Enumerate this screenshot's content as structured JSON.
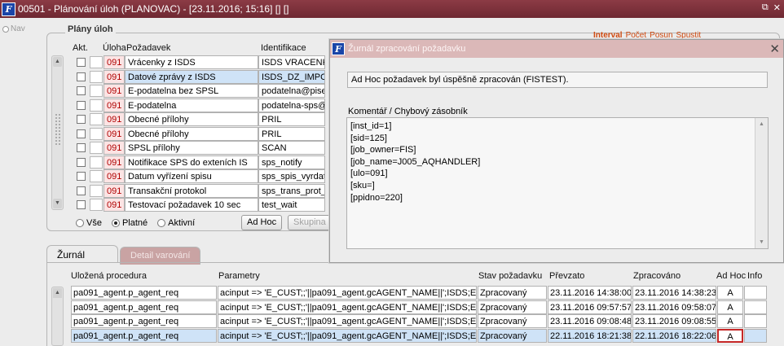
{
  "window": {
    "title": "00501 - Plánování úloh (PLANOVAC) - [23.11.2016; 15:16] [] []",
    "icon_name": "app-logo-icon",
    "ctrl_restore": "⧉",
    "ctrl_close": "✕"
  },
  "nav": {
    "label": "Nav"
  },
  "plans": {
    "title": "Plány úloh",
    "links": {
      "interval": "Interval",
      "pocet": "Počet",
      "posun": "Posun",
      "spustit": "Spustit"
    },
    "headers": {
      "akt": "Akt.",
      "uloha": "Úloha",
      "pozadavek": "Požadavek",
      "identifikace": "Identifikace"
    },
    "rows": [
      {
        "uloha": "091",
        "pozadavek": "Vrácenky z ISDS",
        "ident": "ISDS VRACENKY",
        "active": false
      },
      {
        "uloha": "091",
        "pozadavek": "Datové zprávy z ISDS",
        "ident": "ISDS_DZ_IMPORT",
        "active": true
      },
      {
        "uloha": "091",
        "pozadavek": "E-podatelna bez SPSL",
        "ident": "podatelna@piseka",
        "active": false
      },
      {
        "uloha": "091",
        "pozadavek": "E-podatelna",
        "ident": "podatelna-sps@p",
        "active": false
      },
      {
        "uloha": "091",
        "pozadavek": "Obecné přílohy",
        "ident": "PRIL",
        "active": false
      },
      {
        "uloha": "091",
        "pozadavek": "Obecné přílohy",
        "ident": "PRIL",
        "active": false
      },
      {
        "uloha": "091",
        "pozadavek": "SPSL přílohy",
        "ident": "SCAN",
        "active": false
      },
      {
        "uloha": "091",
        "pozadavek": "Notifikace SPS do exteních IS",
        "ident": "sps_notify",
        "active": false
      },
      {
        "uloha": "091",
        "pozadavek": "Datum vyřízení spisu",
        "ident": "sps_spis_vyrdat",
        "active": false
      },
      {
        "uloha": "091",
        "pozadavek": "Transakční protokol",
        "ident": "sps_trans_prot_d",
        "active": false
      },
      {
        "uloha": "091",
        "pozadavek": "Testovací požadavek 10 sec",
        "ident": "test_wait",
        "active": false
      }
    ],
    "filter": {
      "all": "Vše",
      "valid": "Platné",
      "active": "Aktivní",
      "selected": "valid"
    },
    "buttons": {
      "adhoc": "Ad Hoc",
      "group": "Skupina"
    }
  },
  "tabs": {
    "journal": "Žurnál",
    "warning_detail": "Detail varování"
  },
  "journal": {
    "headers": {
      "procedure": "Uložená procedura",
      "params": "Parametry",
      "state": "Stav požadavku",
      "taken": "Převzato",
      "processed": "Zpracováno",
      "adhoc": "Ad Hoc",
      "info": "Info"
    },
    "rows": [
      {
        "procedure": "pa091_agent.p_agent_req",
        "params": "acinput => 'E_CUST;;'||pa091_agent.gcAGENT_NAME||';ISDS;E_DS_E",
        "state": "Zpracovaný",
        "taken": "23.11.2016 14:38:00",
        "processed": "23.11.2016 14:38:23",
        "adhoc": "A",
        "info": ""
      },
      {
        "procedure": "pa091_agent.p_agent_req",
        "params": "acinput => 'E_CUST;;'||pa091_agent.gcAGENT_NAME||';ISDS;E_DS_E",
        "state": "Zpracovaný",
        "taken": "23.11.2016 09:57:57",
        "processed": "23.11.2016 09:58:07",
        "adhoc": "A",
        "info": ""
      },
      {
        "procedure": "pa091_agent.p_agent_req",
        "params": "acinput => 'E_CUST;;'||pa091_agent.gcAGENT_NAME||';ISDS;E_DS_E",
        "state": "Zpracovaný",
        "taken": "23.11.2016 09:08:48",
        "processed": "23.11.2016 09:08:55",
        "adhoc": "A",
        "info": ""
      },
      {
        "procedure": "pa091_agent.p_agent_req",
        "params": "acinput => 'E_CUST;;'||pa091_agent.gcAGENT_NAME||';ISDS;E_DS_E",
        "state": "Zpracovaný",
        "taken": "22.11.2016 18:21:38",
        "processed": "22.11.2016 18:22:06",
        "adhoc": "A",
        "info": "",
        "active": true
      }
    ]
  },
  "dialog": {
    "title": "Žurnál zpracování požadavku",
    "message": "Ad Hoc požadavek byl úspěšně zpracován (FISTEST).",
    "comment_label": "Komentář / Chybový zásobník",
    "comment_lines": [
      "[inst_id=1]",
      "[sid=125]",
      "[job_owner=FIS]",
      "[job_name=J005_AQHANDLER]",
      "[ulo=091]",
      "[sku=]",
      "[ppidno=220]"
    ]
  }
}
